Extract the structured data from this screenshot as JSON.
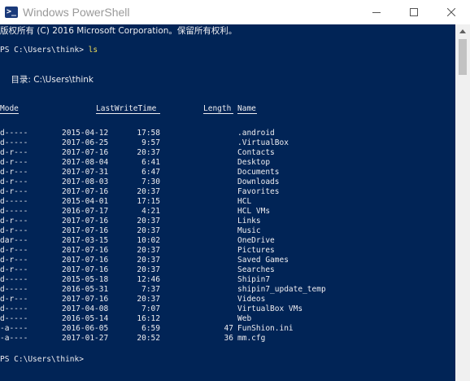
{
  "window": {
    "title": "Windows PowerShell",
    "icon": "powershell-icon",
    "icon_glyph": ">_",
    "controls": [
      "minimize-icon",
      "maximize-icon",
      "close-icon"
    ]
  },
  "console": {
    "copyright": "版权所有 (C) 2016 Microsoft Corporation。保留所有权利。",
    "prompt1": "PS C:\\Users\\think> ",
    "command1": "ls",
    "directory_label": "    目录: C:\\Users\\think",
    "headers": {
      "mode": "Mode",
      "lastwritetime": "LastWriteTime",
      "length": "Length",
      "name": "Name"
    },
    "entries": [
      {
        "mode": "d-----",
        "date": "2015-04-12",
        "time": "17:58",
        "length": "",
        "name": ".android"
      },
      {
        "mode": "d-----",
        "date": "2017-06-25",
        "time": "9:57",
        "length": "",
        "name": ".VirtualBox"
      },
      {
        "mode": "d-r---",
        "date": "2017-07-16",
        "time": "20:37",
        "length": "",
        "name": "Contacts"
      },
      {
        "mode": "d-r---",
        "date": "2017-08-04",
        "time": "6:41",
        "length": "",
        "name": "Desktop"
      },
      {
        "mode": "d-r---",
        "date": "2017-07-31",
        "time": "6:47",
        "length": "",
        "name": "Documents"
      },
      {
        "mode": "d-r---",
        "date": "2017-08-03",
        "time": "7:30",
        "length": "",
        "name": "Downloads"
      },
      {
        "mode": "d-r---",
        "date": "2017-07-16",
        "time": "20:37",
        "length": "",
        "name": "Favorites"
      },
      {
        "mode": "d-----",
        "date": "2015-04-01",
        "time": "17:15",
        "length": "",
        "name": "HCL"
      },
      {
        "mode": "d-----",
        "date": "2016-07-17",
        "time": "4:21",
        "length": "",
        "name": "HCL VMs"
      },
      {
        "mode": "d-r---",
        "date": "2017-07-16",
        "time": "20:37",
        "length": "",
        "name": "Links"
      },
      {
        "mode": "d-r---",
        "date": "2017-07-16",
        "time": "20:37",
        "length": "",
        "name": "Music"
      },
      {
        "mode": "dar---",
        "date": "2017-03-15",
        "time": "10:02",
        "length": "",
        "name": "OneDrive"
      },
      {
        "mode": "d-r---",
        "date": "2017-07-16",
        "time": "20:37",
        "length": "",
        "name": "Pictures"
      },
      {
        "mode": "d-r---",
        "date": "2017-07-16",
        "time": "20:37",
        "length": "",
        "name": "Saved Games"
      },
      {
        "mode": "d-r---",
        "date": "2017-07-16",
        "time": "20:37",
        "length": "",
        "name": "Searches"
      },
      {
        "mode": "d-----",
        "date": "2015-05-18",
        "time": "12:46",
        "length": "",
        "name": "Shipin7"
      },
      {
        "mode": "d-----",
        "date": "2016-05-31",
        "time": "7:37",
        "length": "",
        "name": "shipin7_update_temp"
      },
      {
        "mode": "d-r---",
        "date": "2017-07-16",
        "time": "20:37",
        "length": "",
        "name": "Videos"
      },
      {
        "mode": "d-----",
        "date": "2017-04-08",
        "time": "7:07",
        "length": "",
        "name": "VirtualBox VMs"
      },
      {
        "mode": "d-----",
        "date": "2016-05-14",
        "time": "16:12",
        "length": "",
        "name": "Web"
      },
      {
        "mode": "-a----",
        "date": "2016-06-05",
        "time": "6:59",
        "length": "47",
        "name": "FunShion.ini"
      },
      {
        "mode": "-a----",
        "date": "2017-01-27",
        "time": "20:52",
        "length": "36",
        "name": "mm.cfg"
      }
    ],
    "prompt2": "PS C:\\Users\\think> "
  },
  "colors": {
    "console_bg": "#012456",
    "console_fg": "#eeedf0",
    "command_fg": "#f1de5a",
    "titlebar_bg": "#ffffff",
    "title_fg": "#9a9a9a",
    "scrollbar_bg": "#f0f0f0",
    "scroll_thumb": "#c2c2c2"
  }
}
